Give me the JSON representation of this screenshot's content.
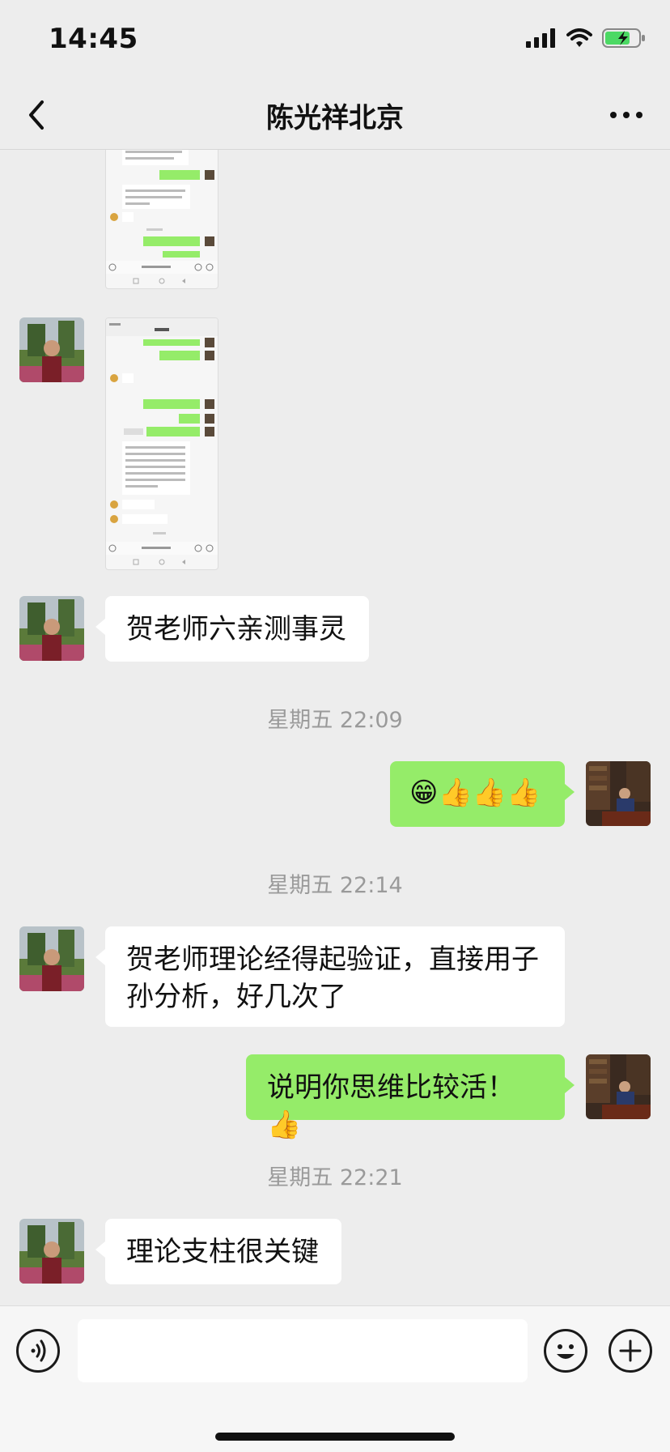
{
  "status": {
    "time": "14:45"
  },
  "nav": {
    "title": "陈光祥北京"
  },
  "messages": {
    "m1": "贺老师六亲测事灵",
    "ts1": "星期五 22:09",
    "m2": "😁👍👍👍",
    "ts2": "星期五 22:14",
    "m3": "贺老师理论经得起验证，直接用子孙分析，好几次了",
    "m4": "说明你思维比较活！👍",
    "ts3": "星期五 22:21",
    "m5": "理论支柱很关键"
  },
  "colors": {
    "bubble_out": "#95ec69",
    "bubble_in": "#ffffff",
    "background": "#ededed"
  }
}
